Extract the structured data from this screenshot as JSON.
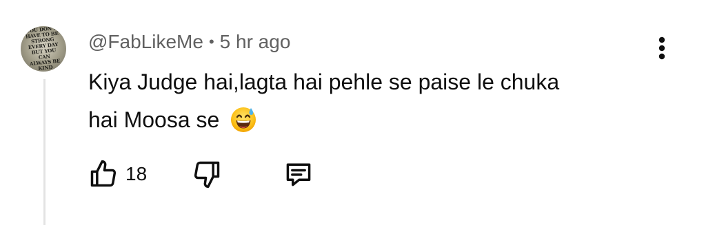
{
  "comment": {
    "author": "@FabLikeMe",
    "separator": "•",
    "time_ago": "5 hr ago",
    "text_line1": "Kiya Judge hai,lagta hai pehle se paise le chuka",
    "text_line2": "hai Moosa se",
    "emoji": "grinning-face-with-sweat",
    "avatar_text": "YOU DON'T\nHAVE TO BE\nSTRONG\nEVERY DAY\nBUT YOU\nCAN\nALWAYS BE\nKIND",
    "like_count": "18"
  },
  "icons": {
    "like": "thumbs-up-icon",
    "dislike": "thumbs-down-icon",
    "reply": "reply-comment-icon",
    "more": "more-vertical-icon"
  },
  "colors": {
    "meta_text": "#606060",
    "body_text": "#0f0f0f",
    "thread_line": "#e3e3e3"
  }
}
